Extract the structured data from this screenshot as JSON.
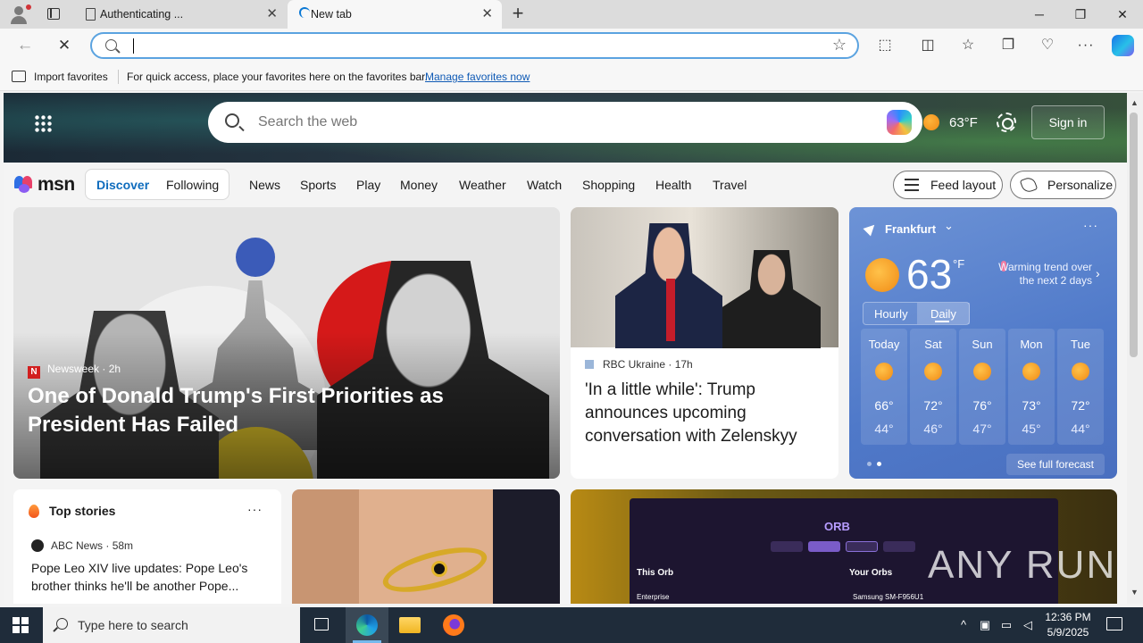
{
  "browser": {
    "tabs": [
      {
        "label": "Authenticating ...",
        "active": false
      },
      {
        "label": "New tab",
        "active": true
      }
    ],
    "new_tab_icon": "plus-icon",
    "window": {
      "minimize": "─",
      "restore": "❐",
      "close": "✕"
    },
    "address": {
      "value": "",
      "placeholder": ""
    },
    "favorites_bar": {
      "import_label": "Import favorites",
      "message": "For quick access, place your favorites here on the favorites bar.",
      "link": "Manage favorites now"
    }
  },
  "msn": {
    "search_placeholder": "Search the web",
    "header_temp": "63°F",
    "sign_in": "Sign in",
    "logo_text": "msn",
    "segments": {
      "discover": "Discover",
      "following": "Following"
    },
    "nav": [
      "News",
      "Sports",
      "Play",
      "Money",
      "Weather",
      "Watch",
      "Shopping",
      "Health",
      "Travel"
    ],
    "feed_layout": "Feed layout",
    "personalize": "Personalize",
    "hero": {
      "source": "Newsweek",
      "source_logo": "N",
      "age": "2h",
      "title": "One of Donald Trump's First Priorities as President Has Failed"
    },
    "news": {
      "source": "RBC Ukraine",
      "age": "17h",
      "title": "'In a little while': Trump announces upcoming conversation with Zelenskyy"
    },
    "weather": {
      "city": "Frankfurt",
      "temp": "63",
      "unit": "°F",
      "alert": "Warming trend over the next 2 days",
      "toggle": {
        "hourly": "Hourly",
        "daily": "Daily"
      },
      "days": [
        {
          "name": "Today",
          "hi": "66°",
          "lo": "44°"
        },
        {
          "name": "Sat",
          "hi": "72°",
          "lo": "46°"
        },
        {
          "name": "Sun",
          "hi": "76°",
          "lo": "47°"
        },
        {
          "name": "Mon",
          "hi": "73°",
          "lo": "45°"
        },
        {
          "name": "Tue",
          "hi": "72°",
          "lo": "44°"
        }
      ],
      "see_full": "See full forecast"
    },
    "top_stories": {
      "heading": "Top stories",
      "source": "ABC News",
      "age": "58m",
      "title": "Pope Leo XIV live updates: Pope Leo's brother thinks he'll be another Pope..."
    },
    "orb_ad": {
      "logo": "ORB",
      "this_orb": "This Orb",
      "your_orbs": "Your Orbs",
      "row1": "Enterprise",
      "row2": "Samsung SM-F956U1"
    },
    "watermark": "ANY RUN"
  },
  "taskbar": {
    "search_placeholder": "Type here to search",
    "time": "12:36 PM",
    "date": "5/9/2025"
  },
  "colors": {
    "accent": "#0f6cbd",
    "taskbar": "#1f2c3a",
    "address_focus": "#5ba3e0",
    "weather_card": "#5b80cc"
  }
}
